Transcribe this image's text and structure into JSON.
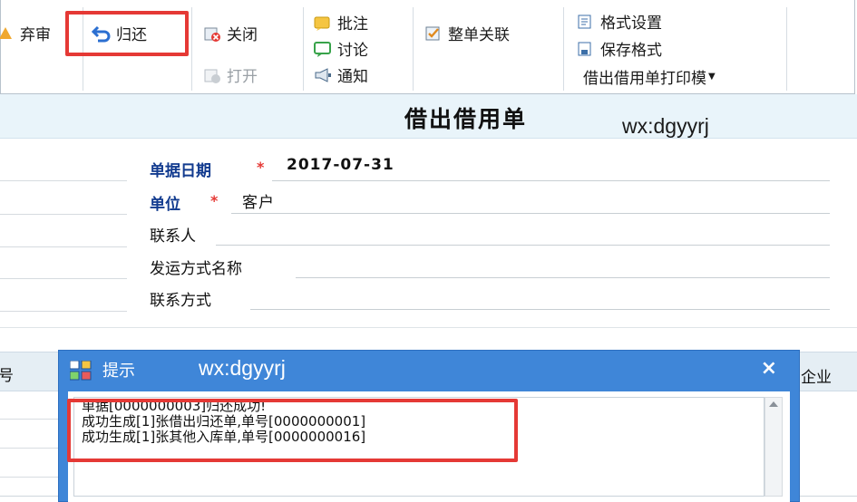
{
  "toolbar": {
    "abandon_label": "弃审",
    "return_label": "归还",
    "close_label": "关闭",
    "open_label": "打开",
    "approve_label": "批注",
    "discuss_label": "讨论",
    "notify_label": "通知",
    "link_label": "整单关联",
    "format_settings_label": "格式设置",
    "save_format_label": "保存格式",
    "print_template_label": "借出借用单打印模"
  },
  "form": {
    "title": "借出借用单",
    "watermark": "wx:dgyyrj",
    "fields": [
      {
        "label": "单据日期",
        "value": "2017-07-31"
      },
      {
        "label": "单位",
        "value": "客户"
      },
      {
        "label": "联系人",
        "value": ""
      },
      {
        "label": "发运方式名称",
        "value": ""
      },
      {
        "label": "联系方式",
        "value": ""
      }
    ]
  },
  "grid": {
    "left_header": "号",
    "right_header": "企业"
  },
  "dialog": {
    "title": "提示",
    "watermark": "wx:dgyyrj",
    "close_symbol": "×",
    "messages": [
      "单据[0000000003]归还成功!",
      "成功生成[1]张借出归还单,单号[0000000001]",
      "成功生成[1]张其他入库单,单号[0000000016]"
    ]
  },
  "colors": {
    "highlight_red": "#e53935",
    "dialog_blue": "#3f86d8",
    "header_band": "#e9f4fa",
    "required_label": "#123b8f"
  }
}
